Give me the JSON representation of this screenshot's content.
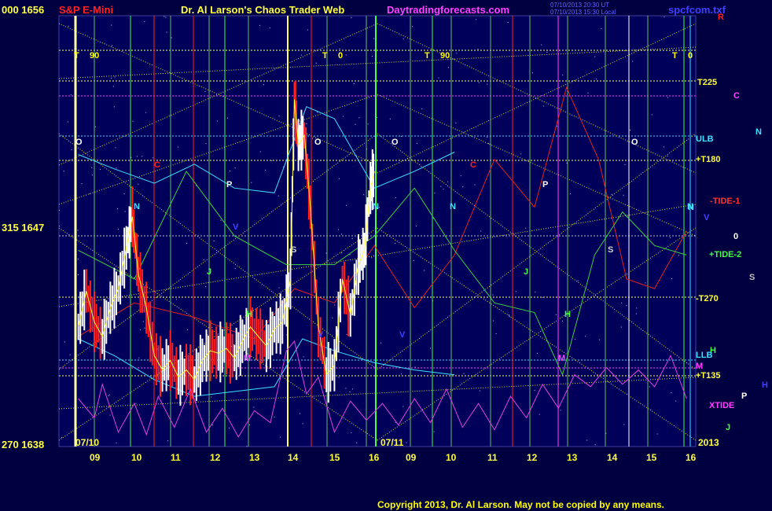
{
  "header": {
    "price_top": "000 1656",
    "instrument": "S&P E-Mini",
    "title": "Dr. Al Larson's Chaos Trader Web",
    "site": "Daytradingforecasts.com",
    "stamp_line1": "07/10/2013 20:30 UT",
    "stamp_line2": "07/10/2013 15:30 Local",
    "file": "spcfcom.txf"
  },
  "left_scale": {
    "mid": "315 1647",
    "bottom": "270 1638"
  },
  "dates": {
    "day1": "07/10",
    "day2": "07/11",
    "year": "2013"
  },
  "x_ticks": [
    "09",
    "10",
    "11",
    "12",
    "13",
    "14",
    "15",
    "16",
    "09",
    "10",
    "11",
    "12",
    "13",
    "14",
    "15",
    "16"
  ],
  "right_labels": [
    {
      "text": "R",
      "color": "#ff2020"
    },
    {
      "text": "T225",
      "color": "#ffff40"
    },
    {
      "text": "C",
      "color": "#ff40ff"
    },
    {
      "text": "N",
      "color": "#40e0ff"
    },
    {
      "text": "ULB",
      "color": "#40e0ff"
    },
    {
      "text": "+T180",
      "color": "#ffff40"
    },
    {
      "text": "-TIDE-1",
      "color": "#ff3030"
    },
    {
      "text": "N",
      "color": "#40e0ff"
    },
    {
      "text": "V",
      "color": "#4040ff"
    },
    {
      "text": "0",
      "color": "#ffffff"
    },
    {
      "text": "+TIDE-2",
      "color": "#40ff40"
    },
    {
      "text": "S",
      "color": "#c0c0c0"
    },
    {
      "text": "-T270",
      "color": "#ffff40"
    },
    {
      "text": "H",
      "color": "#40ff40"
    },
    {
      "text": "LLB",
      "color": "#40e0ff"
    },
    {
      "text": "M",
      "color": "#ff40ff"
    },
    {
      "text": "+T135",
      "color": "#ffff40"
    },
    {
      "text": "H",
      "color": "#4040ff"
    },
    {
      "text": "P",
      "color": "#ffffff"
    },
    {
      "text": "XTIDE",
      "color": "#ff40ff"
    },
    {
      "text": "J",
      "color": "#40ff40"
    }
  ],
  "plot_labels": [
    {
      "text": "T",
      "color": "#ffff00"
    },
    {
      "text": "90",
      "color": "#ffff00"
    },
    {
      "text": "T",
      "color": "#ffff00"
    },
    {
      "text": "0",
      "color": "#ffff00"
    },
    {
      "text": "T",
      "color": "#ffff00"
    },
    {
      "text": "90",
      "color": "#ffff00"
    },
    {
      "text": "T",
      "color": "#ffff00"
    },
    {
      "text": "0",
      "color": "#ffff00"
    },
    {
      "text": "O",
      "color": "#ffffff"
    },
    {
      "text": "O",
      "color": "#ffffff"
    },
    {
      "text": "O",
      "color": "#ffffff"
    },
    {
      "text": "O",
      "color": "#ffffff"
    },
    {
      "text": "C",
      "color": "#ff2020"
    },
    {
      "text": "C",
      "color": "#ff2020"
    },
    {
      "text": "P",
      "color": "#ffffff"
    },
    {
      "text": "P",
      "color": "#ffffff"
    },
    {
      "text": "N",
      "color": "#40e0ff"
    },
    {
      "text": "N",
      "color": "#40e0ff"
    },
    {
      "text": "N",
      "color": "#40e0ff"
    },
    {
      "text": "N",
      "color": "#40e0ff"
    },
    {
      "text": "S",
      "color": "#d0d0d0"
    },
    {
      "text": "S",
      "color": "#d0d0d0"
    },
    {
      "text": "J",
      "color": "#40ff40"
    },
    {
      "text": "J",
      "color": "#40ff40"
    },
    {
      "text": "H",
      "color": "#40ff40"
    },
    {
      "text": "H",
      "color": "#40ff40"
    },
    {
      "text": "M",
      "color": "#ff40ff"
    },
    {
      "text": "M",
      "color": "#ff40ff"
    },
    {
      "text": "V",
      "color": "#4040ff"
    },
    {
      "text": "V",
      "color": "#4040ff"
    },
    {
      "text": "V",
      "color": "#4040ff"
    }
  ],
  "copyright": "Copyright 2013, Dr. Al Larson. May not be copied by any means.",
  "chart_data": {
    "type": "line",
    "ylim": [
      1638,
      1656
    ],
    "x_hours": [
      9,
      10,
      11,
      12,
      13,
      14,
      15,
      16
    ],
    "price": [
      [
        8.6,
        1643.0
      ],
      [
        8.8,
        1644.5
      ],
      [
        9.0,
        1643.2
      ],
      [
        9.2,
        1642.6
      ],
      [
        9.4,
        1643.8
      ],
      [
        9.6,
        1644.6
      ],
      [
        9.8,
        1646.3
      ],
      [
        9.95,
        1647.6
      ],
      [
        10.1,
        1645.2
      ],
      [
        10.3,
        1643.8
      ],
      [
        10.5,
        1641.8
      ],
      [
        10.7,
        1641.2
      ],
      [
        10.9,
        1641.6
      ],
      [
        11.1,
        1640.9
      ],
      [
        11.3,
        1641.2
      ],
      [
        11.5,
        1640.8
      ],
      [
        11.7,
        1641.6
      ],
      [
        11.9,
        1642.0
      ],
      [
        12.1,
        1641.9
      ],
      [
        12.3,
        1642.1
      ],
      [
        12.5,
        1641.7
      ],
      [
        12.7,
        1642.4
      ],
      [
        12.9,
        1643.0
      ],
      [
        13.1,
        1642.6
      ],
      [
        13.3,
        1642.2
      ],
      [
        13.5,
        1642.9
      ],
      [
        13.7,
        1643.2
      ],
      [
        13.9,
        1645.0
      ],
      [
        14.0,
        1652.5
      ],
      [
        14.1,
        1650.6
      ],
      [
        14.25,
        1651.0
      ],
      [
        14.4,
        1648.0
      ],
      [
        14.6,
        1643.0
      ],
      [
        14.8,
        1641.0
      ],
      [
        15.0,
        1641.4
      ],
      [
        15.2,
        1645.0
      ],
      [
        15.4,
        1643.5
      ],
      [
        15.6,
        1645.6
      ],
      [
        15.75,
        1646.2
      ],
      [
        15.9,
        1648.8
      ],
      [
        16.0,
        1649.5
      ]
    ],
    "xtide": [
      [
        8.6,
        1640.0
      ],
      [
        9.0,
        1639.2
      ],
      [
        9.2,
        1640.6
      ],
      [
        9.6,
        1638.6
      ],
      [
        10.0,
        1639.8
      ],
      [
        10.3,
        1638.5
      ],
      [
        10.6,
        1640.1
      ],
      [
        11.0,
        1638.8
      ],
      [
        11.4,
        1640.4
      ],
      [
        11.8,
        1638.6
      ],
      [
        12.2,
        1639.6
      ],
      [
        12.6,
        1638.4
      ],
      [
        13.0,
        1639.5
      ],
      [
        13.4,
        1639.0
      ],
      [
        13.8,
        1642.0
      ],
      [
        14.0,
        1642.4
      ],
      [
        14.3,
        1640.2
      ],
      [
        14.6,
        1640.9
      ],
      [
        15.0,
        1638.6
      ],
      [
        15.4,
        1639.9
      ],
      [
        15.8,
        1639.1
      ],
      [
        16.2,
        1639.8
      ],
      [
        16.6,
        1638.9
      ],
      [
        17.0,
        1640.0
      ],
      [
        17.4,
        1639.0
      ],
      [
        17.8,
        1640.4
      ],
      [
        18.2,
        1638.8
      ],
      [
        18.6,
        1639.8
      ],
      [
        19.0,
        1638.7
      ],
      [
        19.4,
        1640.1
      ],
      [
        19.8,
        1639.2
      ],
      [
        20.2,
        1640.6
      ],
      [
        20.6,
        1639.6
      ],
      [
        21.0,
        1641.0
      ],
      [
        21.4,
        1640.5
      ],
      [
        21.8,
        1641.3
      ],
      [
        22.2,
        1640.6
      ],
      [
        22.6,
        1641.2
      ],
      [
        23.0,
        1640.5
      ],
      [
        23.4,
        1641.8
      ],
      [
        23.8,
        1640.0
      ]
    ],
    "tide1": [
      [
        8.6,
        1642.6
      ],
      [
        10.0,
        1644.0
      ],
      [
        11.5,
        1643.4
      ],
      [
        13.0,
        1642.5
      ],
      [
        14.0,
        1644.6
      ],
      [
        15.0,
        1644.0
      ],
      [
        16.0,
        1646.4
      ],
      [
        17.0,
        1643.8
      ],
      [
        18.0,
        1646.0
      ],
      [
        19.0,
        1650.0
      ],
      [
        20.0,
        1648.0
      ],
      [
        20.8,
        1653.0
      ],
      [
        21.6,
        1650.0
      ],
      [
        22.3,
        1645.0
      ],
      [
        23.0,
        1644.6
      ],
      [
        23.8,
        1647.0
      ]
    ],
    "tide2": [
      [
        8.6,
        1646.2
      ],
      [
        10.0,
        1645.0
      ],
      [
        11.3,
        1649.5
      ],
      [
        12.5,
        1646.8
      ],
      [
        13.8,
        1645.6
      ],
      [
        15.0,
        1645.6
      ],
      [
        16.0,
        1646.8
      ],
      [
        17.0,
        1648.8
      ],
      [
        18.0,
        1646.2
      ],
      [
        19.0,
        1644.0
      ],
      [
        20.0,
        1643.6
      ],
      [
        20.7,
        1641.0
      ],
      [
        21.5,
        1646.0
      ],
      [
        22.2,
        1647.8
      ],
      [
        23.0,
        1646.4
      ],
      [
        23.8,
        1646.0
      ]
    ],
    "flux_upper": [
      [
        8.6,
        1650.2
      ],
      [
        9.5,
        1649.6
      ],
      [
        10.5,
        1649.0
      ],
      [
        11.5,
        1649.8
      ],
      [
        12.5,
        1648.8
      ],
      [
        13.5,
        1648.6
      ],
      [
        14.3,
        1652.2
      ],
      [
        15.0,
        1651.7
      ],
      [
        16.0,
        1648.8
      ],
      [
        17.0,
        1649.5
      ],
      [
        18.0,
        1650.3
      ]
    ],
    "flux_lower": [
      [
        8.6,
        1642.5
      ],
      [
        9.5,
        1641.8
      ],
      [
        10.5,
        1640.8
      ],
      [
        11.5,
        1640.1
      ],
      [
        12.5,
        1640.3
      ],
      [
        13.5,
        1640.5
      ],
      [
        14.2,
        1642.5
      ],
      [
        15.0,
        1642.0
      ],
      [
        16.0,
        1641.5
      ],
      [
        17.0,
        1641.2
      ],
      [
        18.0,
        1641.0
      ]
    ]
  }
}
